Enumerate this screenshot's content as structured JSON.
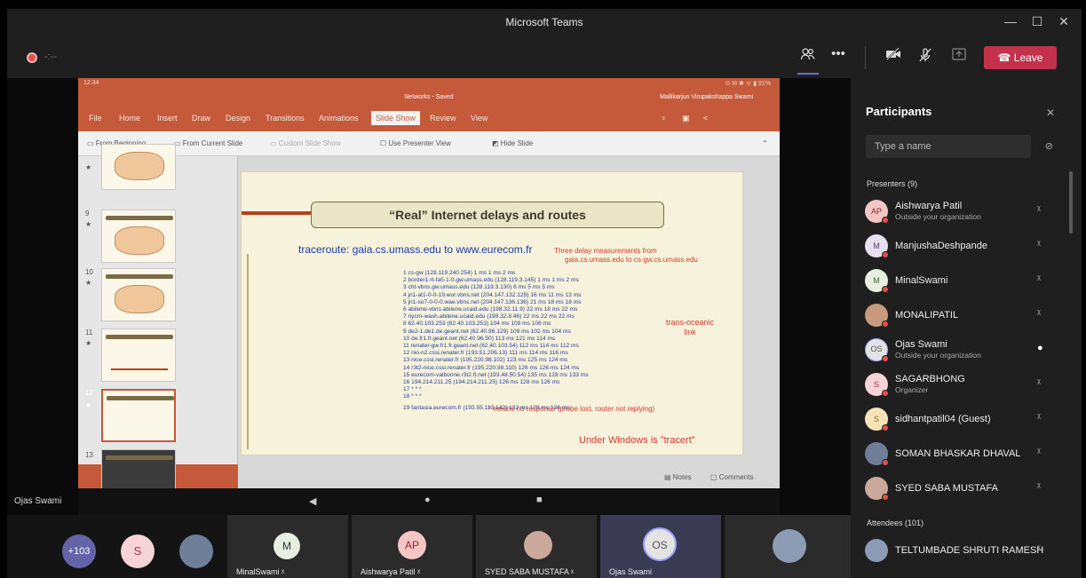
{
  "window": {
    "title": "Microsoft Teams",
    "minimize": "—",
    "maximize": "☐",
    "close": "✕"
  },
  "toolbar": {
    "record_time": "-:--",
    "participants_icon": "people-icon",
    "more": "•••",
    "camera_icon": "camera-off-icon",
    "mic_icon": "mic-off-icon",
    "share_icon": "share-tray-icon",
    "leave_label": "Leave",
    "leave_color": "#c4314b"
  },
  "ppt": {
    "status_time": "12:34",
    "status_right": "⊙ ✉ ✱ ᯤ ▮ 91%",
    "doc_title": "Networks - Saved",
    "user": "Mallikarjun Virupakshappa Swami",
    "tabs": [
      "File",
      "Home",
      "Insert",
      "Draw",
      "Design",
      "Transitions",
      "Animations",
      "Slide Show",
      "Review",
      "View"
    ],
    "commands": [
      "From Beginning",
      "From Current Slide",
      "Custom Slide Show",
      "Use Presenter View",
      "Hide Slide"
    ],
    "thumb_numbers": [
      "9",
      "10",
      "11",
      "12",
      "13"
    ],
    "notes": "Notes",
    "comments": "Comments"
  },
  "slide": {
    "title": "“Real” Internet delays and routes",
    "traceroute": "traceroute: gaia.cs.umass.edu to www.eurecom.fr",
    "delay_note_1": "Three delay measurements from",
    "delay_note_2": "gaia.cs.umass.edu to cs-gw.cs.umass.edu",
    "hops": [
      "1  cs-gw (128.119.240.254)  1 ms  1 ms  2 ms",
      "2  border1-rt-fa5-1-0.gw.umass.edu (128.119.3.145)  1 ms  1 ms  2 ms",
      "3  cht-vbns.gw.umass.edu (128.119.3.130)  6 ms 5 ms 5 ms",
      "4  jn1-at1-0-0-19.wor.vbns.net (204.147.132.129)  16 ms 11 ms 13 ms",
      "5  jn1-so7-0-0-0.wae.vbns.net (204.147.136.136)  21 ms 18 ms 18 ms",
      "6  abilene-vbns.abilene.ucaid.edu (198.32.11.9)  22 ms  18 ms  22 ms",
      "7  nycm-wash.abilene.ucaid.edu (198.32.8.46)  22 ms  22 ms  22 ms",
      "8  62.40.103.253 (62.40.103.253)  104 ms 109 ms 106 ms",
      "9  de2-1.de1.de.geant.net (62.40.96.129)  109 ms 102 ms 104 ms",
      "10  de.fr1.fr.geant.net (62.40.96.50)  113 ms 121 ms 114 ms",
      "11  renater-gw.fr1.fr.geant.net (62.40.103.54)  112 ms  114 ms  112 ms",
      "12  nio-n2.cssi.renater.fr (193.51.206.13)  111 ms  114 ms  116 ms",
      "13  nice.cssi.renater.fr (195.220.98.102)  123 ms  125 ms  124 ms",
      "14  r3t2-nice.cssi.renater.fr (195.220.98.110)  126 ms  126 ms  124 ms",
      "15  eurecom-valbonne.r3t2.ft.net (193.48.50.54)  135 ms  128 ms  133 ms",
      "16  194.214.211.25 (194.214.211.25)  126 ms  128 ms  126 ms",
      "17  * * *",
      "18  * * *",
      "19  fantasia.eurecom.fr (193.55.113.142)  132 ms  128 ms  136 ms"
    ],
    "trans_oceanic_1": "trans-oceanic",
    "trans_oceanic_2": "link",
    "no_response": "* means no response (probe lost, router not replying)",
    "tracert": "Under Windows is \"tracert\""
  },
  "presenter_name": "Ojas Swami",
  "android_nav": {
    "back": "◀",
    "home": "●",
    "recents": "■"
  },
  "bottom_strip": {
    "overflow_count": "+103",
    "s_initial": "S",
    "tiles": [
      {
        "initials": "M",
        "name": "MinalSwami"
      },
      {
        "initials": "AP",
        "name": "Aishwarya Patil"
      },
      {
        "initials": "",
        "name": "SYED SABA MUSTAFA"
      },
      {
        "initials": "OS",
        "name": "Ojas Swami"
      }
    ]
  },
  "participants": {
    "title": "Participants",
    "search_placeholder": "Type a name",
    "presenters_header": "Presenters (9)",
    "attendees_header": "Attendees (101)",
    "presenters": [
      {
        "initials": "AP",
        "name": "Aishwarya Patil",
        "sub": "Outside your organization",
        "color": "#f4c6c3"
      },
      {
        "initials": "M",
        "name": "ManjushaDeshpande",
        "sub": "",
        "color": "#e8e0ef"
      },
      {
        "initials": "M",
        "name": "MinalSwami",
        "sub": "",
        "color": "#e6efe0"
      },
      {
        "initials": "",
        "name": "MONALIPATIL",
        "sub": "",
        "color": "#c79a7e"
      },
      {
        "initials": "OS",
        "name": "Ojas Swami",
        "sub": "Outside your organization",
        "color": "#e3e3e3"
      },
      {
        "initials": "S",
        "name": "SAGARBHONG",
        "sub": "Organizer",
        "color": "#f6d3d6"
      },
      {
        "initials": "S",
        "name": "sidhantpatil04 (Guest)",
        "sub": "",
        "color": "#f6e3b8"
      },
      {
        "initials": "",
        "name": "SOMAN BHASKAR DHAVAL",
        "sub": "",
        "color": "#6f7f9a"
      },
      {
        "initials": "",
        "name": "SYED SABA MUSTAFA",
        "sub": "",
        "color": "#caa99a"
      }
    ],
    "attendees": [
      {
        "initials": "",
        "name": "TELTUMBADE SHRUTI RAMESH",
        "color": "#8c9cb4"
      }
    ]
  }
}
